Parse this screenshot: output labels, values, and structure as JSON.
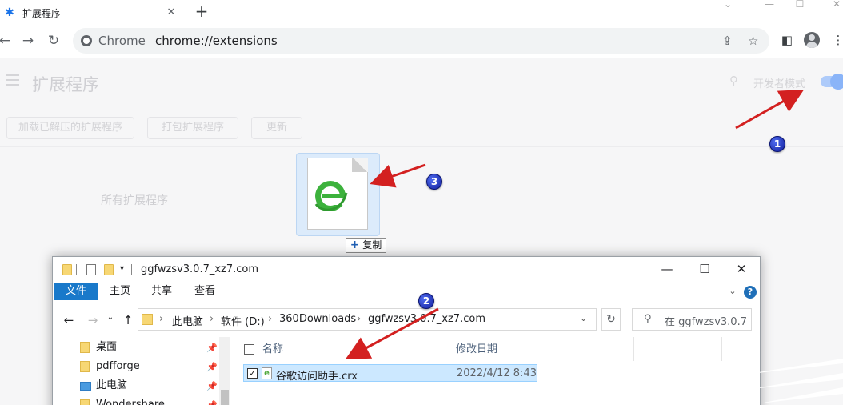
{
  "browser": {
    "tab": {
      "favicon": "puzzle-icon",
      "title": "扩展程序"
    },
    "omnibox": {
      "label": "Chrome",
      "url": "chrome://extensions"
    }
  },
  "extensions_page": {
    "title": "扩展程序",
    "dev_mode_label": "开发者模式",
    "dev_mode_on": true,
    "buttons": [
      "加载已解压的扩展程序",
      "打包扩展程序",
      "更新"
    ],
    "all_extensions_label": "所有扩展程序"
  },
  "drag": {
    "file_icon": "ie-e-icon",
    "copy_label": "复制"
  },
  "explorer": {
    "title": "ggfwzsv3.0.7_xz7.com",
    "ribbon_tabs": [
      "文件",
      "主页",
      "共享",
      "查看"
    ],
    "breadcrumb": [
      "此电脑",
      "软件 (D:)",
      "360Downloads",
      "ggfwzsv3.0.7_xz7.com"
    ],
    "search_placeholder": "在 ggfwzsv3.0.7_...",
    "nav_items": [
      "桌面",
      "pdfforge",
      "此电脑",
      "Wondershare"
    ],
    "columns": [
      "名称",
      "修改日期"
    ],
    "files": [
      {
        "name": "谷歌访问助手.crx",
        "date": "2022/4/12 8:43",
        "checked": true
      }
    ]
  },
  "annotations": {
    "badges": [
      "1",
      "2",
      "3"
    ],
    "arrow_color": "#d32020"
  },
  "colors": {
    "accent": "#1a73e8",
    "ribbon_file": "#1979ca",
    "selection": "#cce8ff"
  }
}
